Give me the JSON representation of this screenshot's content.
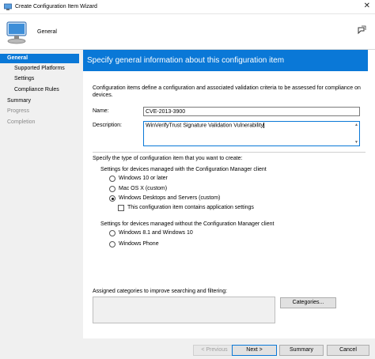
{
  "window": {
    "title": "Create Configuration Item Wizard"
  },
  "header": {
    "step_title": "General"
  },
  "sidebar": {
    "items": [
      {
        "label": "General",
        "state": "selected"
      },
      {
        "label": "Supported Platforms",
        "state": "normal"
      },
      {
        "label": "Settings",
        "state": "normal"
      },
      {
        "label": "Compliance Rules",
        "state": "normal"
      },
      {
        "label": "Summary",
        "state": "normal"
      },
      {
        "label": "Progress",
        "state": "disabled"
      },
      {
        "label": "Completion",
        "state": "disabled"
      }
    ]
  },
  "main": {
    "banner": "Specify general information about this configuration item",
    "description": "Configuration items define a configuration and associated validation criteria to be assessed for compliance on devices.",
    "name_label": "Name:",
    "name_value": "CVE-2013-3900",
    "description_label": "Description:",
    "description_value": "WinVerifyTrust Signature Validation Vulnerability",
    "type_prompt": "Specify the type of configuration item that you want to create:",
    "with_client_label": "Settings for devices managed with the Configuration Manager client",
    "with_client_options": [
      {
        "label": "Windows 10 or later",
        "checked": false
      },
      {
        "label": "Mac OS X (custom)",
        "checked": false
      },
      {
        "label": "Windows Desktops and Servers (custom)",
        "checked": true
      }
    ],
    "app_settings_checkbox": {
      "label": "This configuration item contains application settings",
      "checked": false
    },
    "without_client_label": "Settings for devices managed without the Configuration Manager client",
    "without_client_options": [
      {
        "label": "Windows 8.1 and Windows 10",
        "checked": false
      },
      {
        "label": "Windows Phone",
        "checked": false
      }
    ],
    "categories_label": "Assigned categories to improve searching and filtering:",
    "categories_button": "Categories..."
  },
  "footer": {
    "previous": "< Previous",
    "next": "Next >",
    "summary": "Summary",
    "cancel": "Cancel"
  },
  "colors": {
    "accent": "#0a78d7",
    "sidebar_bg": "#f0f0f0"
  }
}
